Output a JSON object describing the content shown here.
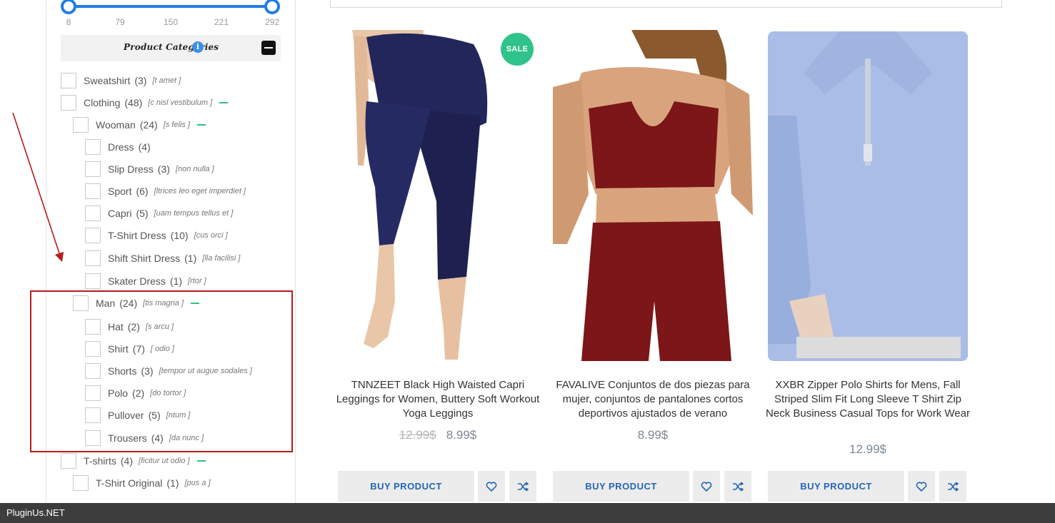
{
  "price_slider": {
    "min_value": 8,
    "max_value": 292,
    "ticks": [
      "8",
      "79",
      "150",
      "221",
      "292"
    ]
  },
  "categories": {
    "title": "Product Categories",
    "info_icon": "info-icon",
    "collapse_icon": "minus-square-icon",
    "items": [
      {
        "name": "Sweatshirt",
        "count": "(3)",
        "desc": "[t amet ]",
        "expanded": false
      },
      {
        "name": "Clothing",
        "count": "(48)",
        "desc": "[c nisl vestibulum ]",
        "expanded": true
      },
      {
        "name": "Wooman",
        "count": "(24)",
        "desc": "[s felis ]",
        "expanded": true
      },
      {
        "name": "Dress",
        "count": "(4)",
        "desc": "",
        "expanded": false
      },
      {
        "name": "Slip Dress",
        "count": "(3)",
        "desc": "[non nulla ]",
        "expanded": false
      },
      {
        "name": "Sport",
        "count": "(6)",
        "desc": "[ltrices leo eget imperdiet ]",
        "expanded": false
      },
      {
        "name": "Capri",
        "count": "(5)",
        "desc": "[uam tempus tellus et ]",
        "expanded": false
      },
      {
        "name": "T-Shirt Dress",
        "count": "(10)",
        "desc": "[cus orci ]",
        "expanded": false
      },
      {
        "name": "Shift Shirt Dress",
        "count": "(1)",
        "desc": "[lla facilisi ]",
        "expanded": false
      },
      {
        "name": "Skater Dress",
        "count": "(1)",
        "desc": "[rtor ]",
        "expanded": false
      },
      {
        "name": "Man",
        "count": "(24)",
        "desc": "[tis magna ]",
        "expanded": true
      },
      {
        "name": "Hat",
        "count": "(2)",
        "desc": "[s arcu ]",
        "expanded": false
      },
      {
        "name": "Shirt",
        "count": "(7)",
        "desc": "[ odio ]",
        "expanded": false
      },
      {
        "name": "Shorts",
        "count": "(3)",
        "desc": "[tempor ut augue sodales ]",
        "expanded": false
      },
      {
        "name": "Polo",
        "count": "(2)",
        "desc": "[do tortor ]",
        "expanded": false
      },
      {
        "name": "Pullover",
        "count": "(5)",
        "desc": "[ntum ]",
        "expanded": false
      },
      {
        "name": "Trousers",
        "count": "(4)",
        "desc": "[da nunc ]",
        "expanded": false
      },
      {
        "name": "T-shirts",
        "count": "(4)",
        "desc": "[ficitur ut odio ]",
        "expanded": true
      },
      {
        "name": "T-Shirt Original",
        "count": "(1)",
        "desc": "[pus a ]",
        "expanded": false
      }
    ]
  },
  "products": [
    {
      "title": "TNNZEET Black High Waisted Capri Leggings for Women, Buttery Soft Workout Yoga Leggings",
      "old_price": "12.99$",
      "price": "8.99$",
      "badge": "SALE",
      "buy_label": "BUY PRODUCT",
      "image_icon": "leggings-photo",
      "colors": {
        "garment": "#23265a",
        "skin": "#e9c6a8"
      }
    },
    {
      "title": "FAVALIVE Conjuntos de dos piezas para mujer, conjuntos de pantalones cortos deportivos ajustados de verano",
      "old_price": "",
      "price": "8.99$",
      "badge": "",
      "buy_label": "BUY PRODUCT",
      "image_icon": "two-piece-set-photo",
      "colors": {
        "garment": "#7c1618",
        "skin": "#d9a47d"
      }
    },
    {
      "title": "XXBR Zipper Polo Shirts for Mens, Fall Striped Slim Fit Long Sleeve T Shirt Zip Neck Business Casual Tops for Work Wear",
      "old_price": "",
      "price": "12.99$",
      "badge": "",
      "buy_label": "BUY PRODUCT",
      "image_icon": "polo-shirt-photo",
      "colors": {
        "garment": "#a9bde6",
        "skin": "#e8d2bf"
      }
    }
  ],
  "footer": {
    "brand": "PluginUs.NET"
  },
  "colors": {
    "accent": "#1f7de6",
    "sale": "#2fc38b",
    "highlight": "#b81c1c",
    "button_text": "#2266b6"
  }
}
